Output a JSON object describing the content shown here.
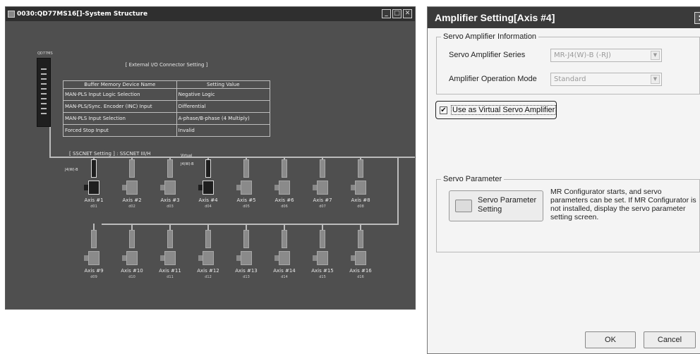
{
  "system_window": {
    "title": "0030:QD77MS16[]-System Structure",
    "controls": {
      "minimize": "_",
      "restore": "□",
      "close": "✕"
    },
    "cpu_module_label": "QD77MS",
    "io_caption": "[ External I/O Connector Setting ]",
    "io_table": {
      "headers": [
        "Buffer Memory Device Name",
        "Setting Value"
      ],
      "rows": [
        [
          "MAN-PLS Input Logic Selection",
          "Negative Logic"
        ],
        [
          "MAN-PLS/Sync. Encoder (INC) Input",
          "Differential"
        ],
        [
          "MAN-PLS Input Selection",
          "A-phase/B-phase (4 Multiply)"
        ],
        [
          "Forced Stop Input",
          "Invalid"
        ]
      ]
    },
    "sscnet_label": "[ SSCNET Setting ] : SSCNET III/H",
    "amp_type_axis1": "J4(W)-B",
    "amp_type_axis4_virtual": "Virtual",
    "amp_type_axis4": "J4(W)-B",
    "axes_row1": [
      {
        "label": "Axis #1",
        "sub": "d01"
      },
      {
        "label": "Axis #2",
        "sub": "d02"
      },
      {
        "label": "Axis #3",
        "sub": "d03"
      },
      {
        "label": "Axis #4",
        "sub": "d04"
      },
      {
        "label": "Axis #5",
        "sub": "d05"
      },
      {
        "label": "Axis #6",
        "sub": "d06"
      },
      {
        "label": "Axis #7",
        "sub": "d07"
      },
      {
        "label": "Axis #8",
        "sub": "d08"
      }
    ],
    "axes_row2": [
      {
        "label": "Axis #9",
        "sub": "d09"
      },
      {
        "label": "Axis #10",
        "sub": "d10"
      },
      {
        "label": "Axis #11",
        "sub": "d11"
      },
      {
        "label": "Axis #12",
        "sub": "d12"
      },
      {
        "label": "Axis #13",
        "sub": "d13"
      },
      {
        "label": "Axis #14",
        "sub": "d14"
      },
      {
        "label": "Axis #15",
        "sub": "d15"
      },
      {
        "label": "Axis #16",
        "sub": "d16"
      }
    ]
  },
  "amp_dialog": {
    "title": "Amplifier Setting[Axis #4]",
    "close_glyph": "✕",
    "servo_info_group": "Servo Amplifier Information",
    "series_label": "Servo Amplifier Series",
    "series_value": "MR-J4(W)-B (-RJ)",
    "mode_label": "Amplifier Operation Mode",
    "mode_value": "Standard",
    "combo_arrow": "▼",
    "virtual_checked_glyph": "✔",
    "virtual_label": "Use as Virtual Servo Amplifier",
    "servo_param_group": "Servo Parameter",
    "servo_param_button": "Servo Parameter Setting",
    "servo_param_desc": "MR Configurator starts, and servo parameters can be set. If MR Configurator is not installed, display the servo parameter setting screen.",
    "ok_label": "OK",
    "cancel_label": "Cancel"
  }
}
